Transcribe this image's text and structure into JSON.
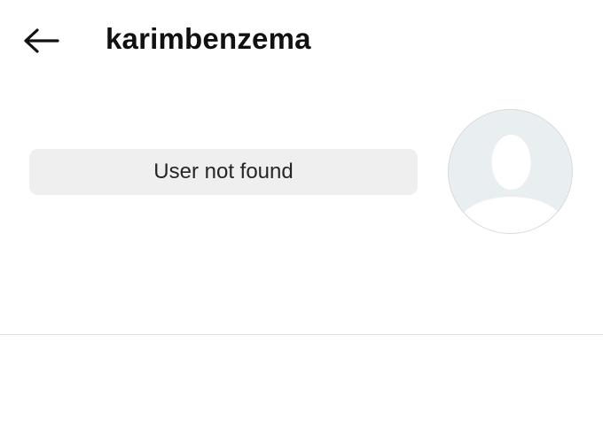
{
  "header": {
    "back_icon": "arrow-left-icon",
    "username": "karimbenzema"
  },
  "profile": {
    "status_text": "User not found",
    "avatar_icon": "default-avatar-icon"
  },
  "colors": {
    "background": "#ffffff",
    "status_pill_bg": "#efefef",
    "avatar_bg": "#e9eef1",
    "avatar_silhouette": "#ffffff",
    "divider": "#e2e2e2"
  }
}
